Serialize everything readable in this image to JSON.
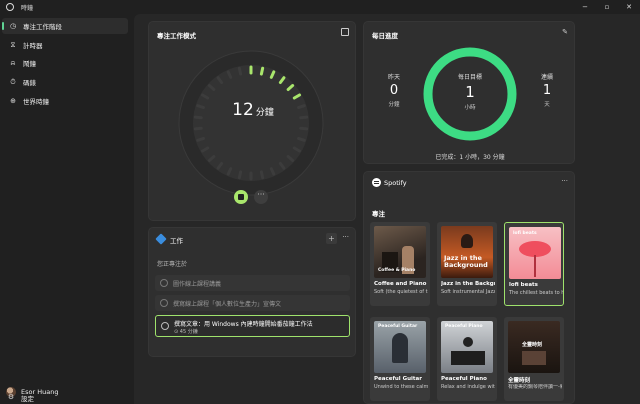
{
  "window": {
    "title": "時鐘"
  },
  "sidebar": {
    "items": [
      {
        "label": "專注工作階段",
        "icon": "focus-icon"
      },
      {
        "label": "計時器",
        "icon": "timer-icon"
      },
      {
        "label": "鬧鐘",
        "icon": "alarm-icon"
      },
      {
        "label": "碼錶",
        "icon": "stopwatch-icon"
      },
      {
        "label": "世界時鐘",
        "icon": "globe-icon"
      }
    ],
    "user": "Esor Huang",
    "settings": "設定"
  },
  "focus": {
    "title": "專注工作模式",
    "minutes": "12",
    "unit": "分鐘",
    "more": "···"
  },
  "progress": {
    "title": "每日進度",
    "yesterday": {
      "label": "昨天",
      "value": "0",
      "unit": "分鐘"
    },
    "goal": {
      "label": "每日目標",
      "value": "1",
      "unit": "小時"
    },
    "streak": {
      "label": "連續",
      "value": "1",
      "unit": "天"
    },
    "completed": "已完成：1 小時，30 分鐘"
  },
  "tasks": {
    "title": "工作",
    "add": "+",
    "more": "···",
    "subtitle": "您正專注於",
    "items": [
      {
        "label": "圖作線上課程講義"
      },
      {
        "label": "撰寫線上課程「個人數位生產力」宣傳文"
      },
      {
        "label": "撰寫文章：用 Windows 內建時鐘開始番茄鐘工作法",
        "sub": "⊙ 45 分鐘"
      }
    ]
  },
  "spotify": {
    "name": "Spotify",
    "more": "···",
    "section": "專注",
    "playlists": [
      {
        "name": "Coffee and Piano",
        "desc": "Soft (the quietest of them all), subtle, n...",
        "cover_text": "Coffee & Piano"
      },
      {
        "name": "Jazz in the Backgr...",
        "desc": "Soft instrumental Jazz for all your...",
        "cover_text": "Jazz in the Background"
      },
      {
        "name": "lofi beats",
        "desc": "The chillest beats to help you relax, stud...",
        "cover_text": "lofi beats"
      },
      {
        "name": "Peaceful Guitar",
        "desc": "Unwind to these calm classical guita...",
        "cover_text": "Peaceful Guitar"
      },
      {
        "name": "Peaceful Piano",
        "desc": "Relax and indulge with beautiful piano...",
        "cover_text": "Peaceful Piano"
      },
      {
        "name": "全靈時刻",
        "desc": "有優美的鋼琴陪伴讀一-就像身處於怡...",
        "cover_text": "全靈時刻"
      }
    ]
  },
  "colors": {
    "accent": "#60d394",
    "ring": "#3ddc84",
    "active_border": "#9fe36c"
  }
}
